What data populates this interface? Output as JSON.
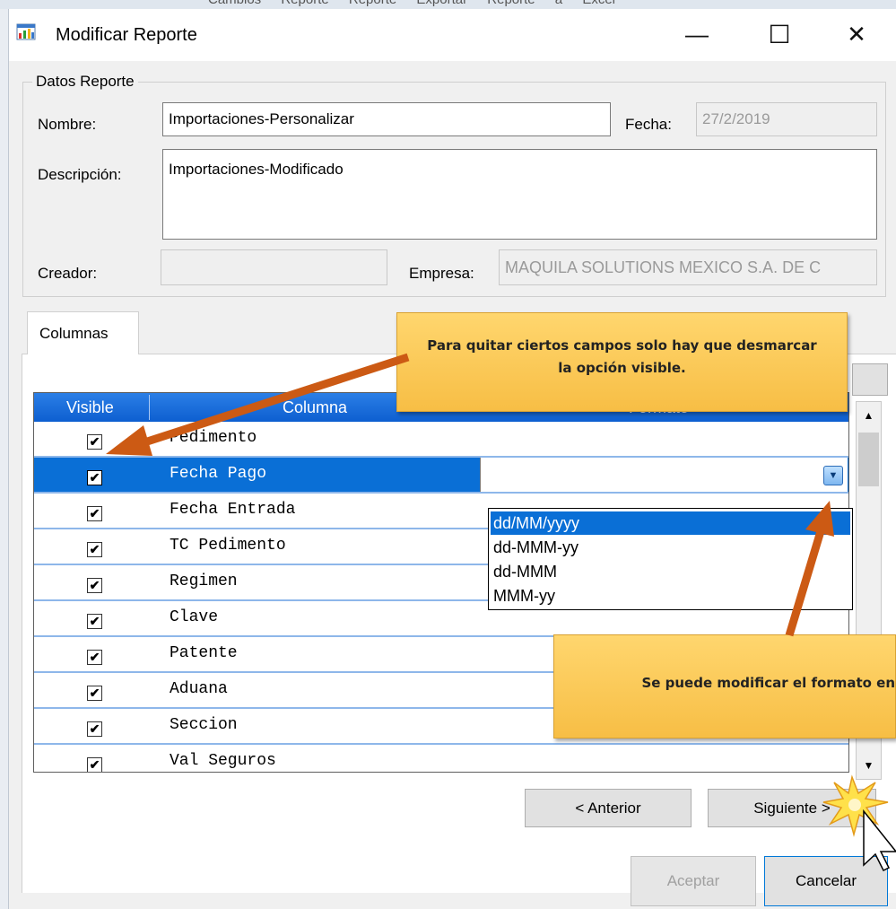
{
  "background": {
    "menu_text": "Cambios Reporte Reporte Exportar Reporte a Excel"
  },
  "window": {
    "title": "Modificar Reporte",
    "controls": {
      "minimize": "—",
      "maximize": "☐",
      "close": "✕"
    }
  },
  "datos": {
    "legend": "Datos Reporte",
    "nombre_label": "Nombre:",
    "nombre_value": "Importaciones-Personalizar",
    "fecha_label": "Fecha:",
    "fecha_value": "27/2/2019",
    "descripcion_label": "Descripción:",
    "descripcion_value": "Importaciones-Modificado",
    "creador_label": "Creador:",
    "creador_value": "",
    "empresa_label": "Empresa:",
    "empresa_value": "MAQUILA SOLUTIONS MEXICO S.A. DE C"
  },
  "tabs": [
    {
      "label": "Columnas",
      "active": true
    }
  ],
  "grid": {
    "headers": {
      "visible": "Visible",
      "columna": "Columna",
      "formato": "Formato"
    },
    "rows": [
      {
        "visible": true,
        "columna": "Pedimento"
      },
      {
        "visible": true,
        "columna": "Fecha Pago",
        "selected": true
      },
      {
        "visible": true,
        "columna": "Fecha Entrada"
      },
      {
        "visible": true,
        "columna": "TC Pedimento"
      },
      {
        "visible": true,
        "columna": "Regimen"
      },
      {
        "visible": true,
        "columna": "Clave"
      },
      {
        "visible": true,
        "columna": "Patente"
      },
      {
        "visible": true,
        "columna": "Aduana"
      },
      {
        "visible": true,
        "columna": "Seccion"
      },
      {
        "visible": true,
        "columna": "Val Seguros"
      }
    ],
    "format_options": [
      "dd/MM/yyyy",
      "dd-MMM-yy",
      "dd-MMM",
      "MMM-yy"
    ],
    "selected_option": "dd/MM/yyyy",
    "checkmark": "✔",
    "dropdown_arrow": "▼"
  },
  "scrollbar": {
    "up": "▲",
    "down": "▼"
  },
  "buttons": {
    "anterior": "< Anterior",
    "siguiente": "Siguiente >",
    "aceptar": "Aceptar",
    "cancelar": "Cancelar"
  },
  "callouts": {
    "top": "Para quitar ciertos campos solo hay que desmarcar la opción visible.",
    "bottom": "Se puede modificar el formato en"
  },
  "colors": {
    "header_blue": "#0d5fd0",
    "selection_blue": "#0a6fd6",
    "callout_yellow": "#f7be45",
    "arrow_orange": "#cc5a14"
  }
}
